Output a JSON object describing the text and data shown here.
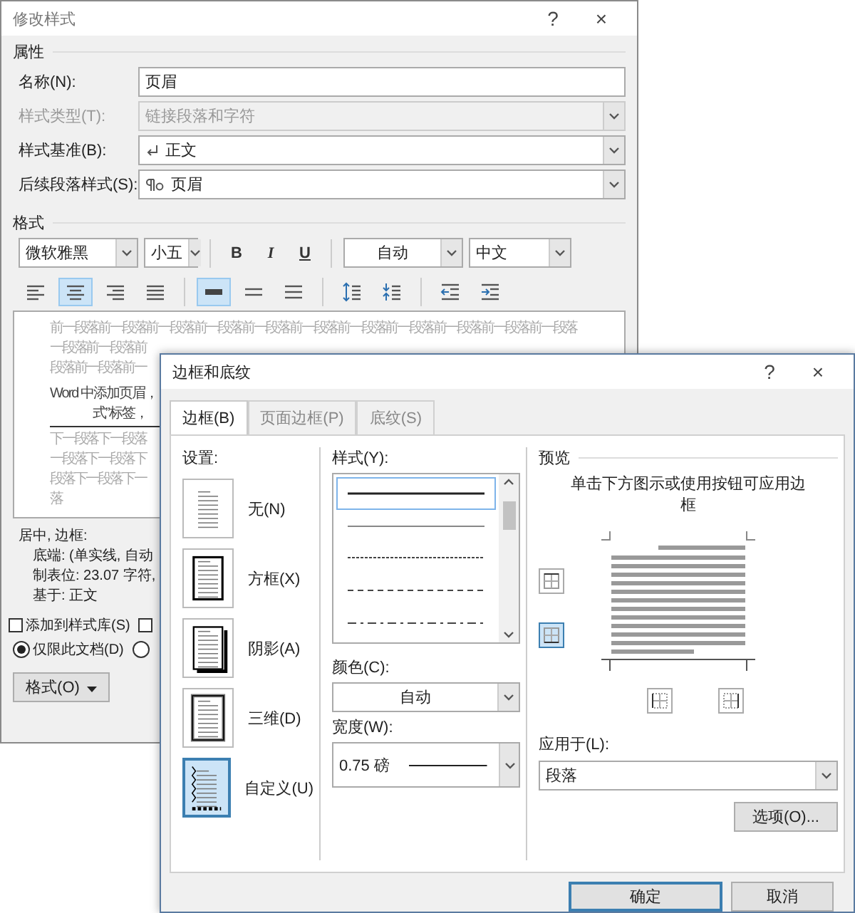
{
  "style_dialog": {
    "title": "修改样式",
    "help": "?",
    "close": "×",
    "properties": {
      "heading": "属性",
      "fields": [
        {
          "label": "名称(N):",
          "value": "页眉",
          "kind": "text",
          "disabled": false
        },
        {
          "label": "样式类型(T):",
          "value": "链接段落和字符",
          "kind": "type",
          "disabled": true
        },
        {
          "label": "样式基准(B):",
          "value": "正文",
          "kind": "base",
          "disabled": false
        },
        {
          "label": "后续段落样式(S):",
          "value": "页眉",
          "kind": "next",
          "disabled": false
        }
      ]
    },
    "format": {
      "heading": "格式",
      "font": "微软雅黑",
      "size": "小五",
      "styles": [
        {
          "kind": "bold",
          "label": "B"
        },
        {
          "kind": "italic",
          "label": "I"
        },
        {
          "kind": "underline",
          "label": "U"
        }
      ],
      "color_mode": "自动",
      "script": "中文",
      "paragraph_buttons": [
        {
          "kind": "align-left",
          "selected": false
        },
        {
          "kind": "align-center",
          "selected": true
        },
        {
          "kind": "align-right",
          "selected": false
        },
        {
          "kind": "justify",
          "selected": false
        },
        {
          "kind": "single",
          "selected": true
        },
        {
          "kind": "onehalf",
          "selected": false
        },
        {
          "kind": "double",
          "selected": false
        },
        {
          "kind": "space-up",
          "selected": false
        },
        {
          "kind": "space-down",
          "selected": false
        },
        {
          "kind": "outdent",
          "selected": false
        },
        {
          "kind": "indent",
          "selected": false
        }
      ]
    },
    "preview": {
      "previous": [
        "前一段落前一段落前一段落前一段落前一段落前一段落前一段落前一段落前一段落前一段落前一段落",
        "一段落前一段落前",
        "段落前一段落前一"
      ],
      "sample": [
        "Word 中添加页眉，",
        "式”标签，"
      ],
      "next": [
        "下一段落下一段落",
        "一段落下一段落下",
        "段落下一段落下一",
        "落"
      ]
    },
    "description": [
      "居中, 边框:",
      "底端: (单实线, 自动",
      "制表位: 23.07 字符,",
      "基于: 正文"
    ],
    "checkboxes": [
      {
        "label": "添加到样式库(S)",
        "checked": false
      },
      {
        "checked": false
      }
    ],
    "radios": [
      {
        "label": "仅限此文档(D)",
        "selected": true
      },
      {
        "selected": false
      }
    ],
    "format_button": "格式(O)"
  },
  "borders_dialog": {
    "title": "边框和底纹",
    "help": "?",
    "close": "×",
    "tabs": [
      {
        "label": "边框(B)",
        "selected": true
      },
      {
        "label": "页面边框(P)",
        "selected": false
      },
      {
        "label": "底纹(S)",
        "selected": false
      }
    ],
    "settings": {
      "label": "设置:",
      "options": [
        {
          "kind": "none",
          "label": "无(N)",
          "selected": false
        },
        {
          "kind": "box",
          "label": "方框(X)",
          "selected": false
        },
        {
          "kind": "shadow",
          "label": "阴影(A)",
          "selected": false
        },
        {
          "kind": "threed",
          "label": "三维(D)",
          "selected": false
        },
        {
          "kind": "custom",
          "label": "自定义(U)",
          "selected": true
        }
      ]
    },
    "style": {
      "label": "样式(Y):",
      "lines": [
        {
          "kind": "solid",
          "selected": true
        },
        {
          "kind": "thin",
          "selected": false
        },
        {
          "kind": "dotted",
          "selected": false
        },
        {
          "kind": "dashed",
          "selected": false
        },
        {
          "kind": "dashdot",
          "selected": false
        }
      ]
    },
    "color": {
      "label": "颜色(C):",
      "value": "自动"
    },
    "width": {
      "label": "宽度(W):",
      "value": "0.75 磅"
    },
    "preview": {
      "heading": "预览",
      "hint": "单击下方图示或使用按钮可应用边框",
      "border_buttons": [
        {
          "kind": "top",
          "selected": false
        },
        {
          "kind": "bottom",
          "selected": true
        },
        {
          "kind": "left",
          "selected": false
        },
        {
          "kind": "right",
          "selected": false
        }
      ]
    },
    "apply_to": {
      "label": "应用于(L):",
      "value": "段落"
    },
    "options_button": "选项(O)...",
    "buttons": [
      {
        "label": "确定",
        "kind": "default"
      },
      {
        "label": "取消",
        "kind": "normal"
      }
    ]
  }
}
